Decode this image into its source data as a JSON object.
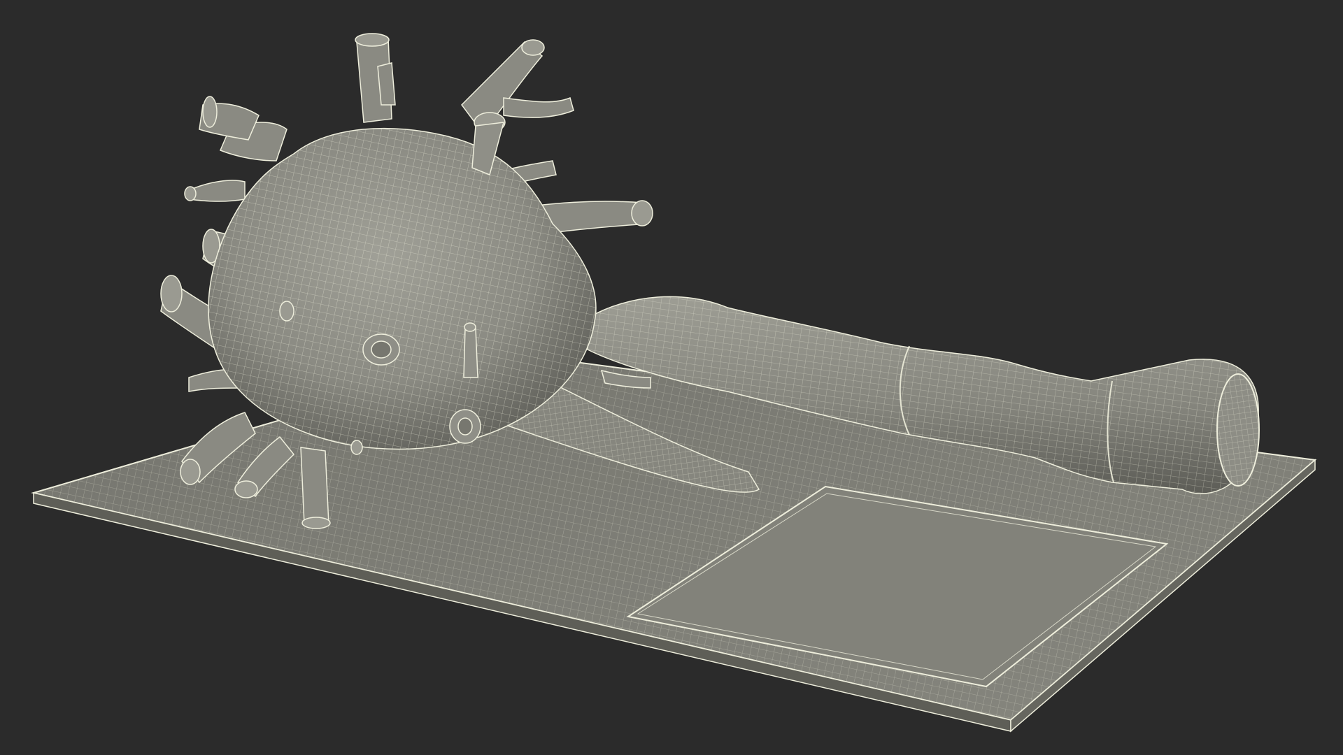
{
  "scene": {
    "background_color": "#2b2b2b",
    "mesh_fill_color": "#8a8a82",
    "mesh_shadow_color": "#55554f",
    "mesh_highlight_color": "#a4a49b",
    "wire_color": "#eeeedc",
    "base_fill_color": "#7e7e76",
    "base_edge_color": "#5e5e57",
    "subject": "neuron-wireframe-model"
  }
}
